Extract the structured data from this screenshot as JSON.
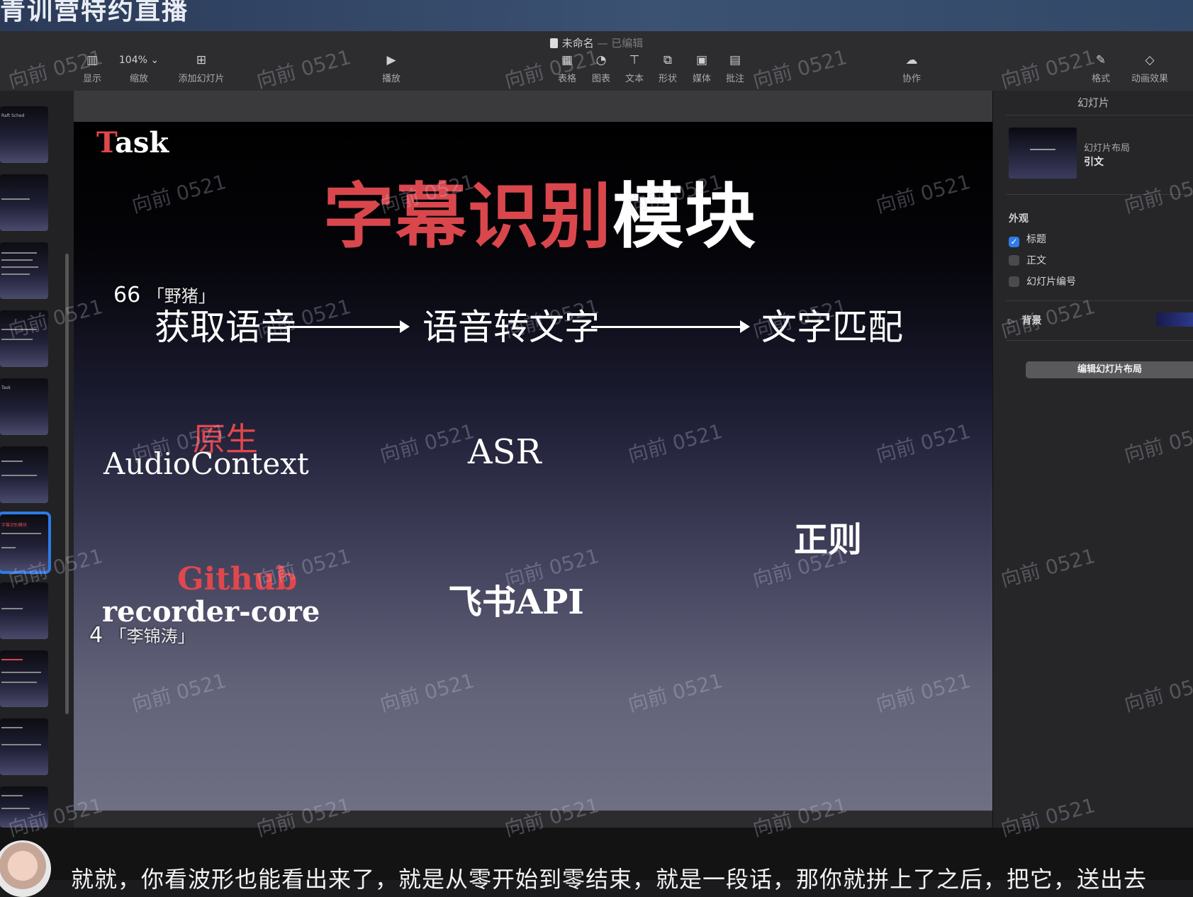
{
  "stream_banner": {
    "title": "青训营特约直播"
  },
  "toolbar": {
    "document_title": "未命名",
    "document_status": "— 已编辑",
    "view_label": "显示",
    "zoom_value": "104%",
    "zoom_label": "缩放",
    "add_slide_label": "添加幻灯片",
    "play_label": "播放",
    "table_label": "表格",
    "chart_label": "图表",
    "text_label": "文本",
    "shape_label": "形状",
    "media_label": "媒体",
    "comment_label": "批注",
    "collaborate_label": "协作",
    "format_label": "格式",
    "animate_label": "动画效果"
  },
  "navigator": {
    "thumbnails": [
      {
        "label": "Raft Sched"
      },
      {
        "label": ""
      },
      {
        "label": ""
      },
      {
        "label": ""
      },
      {
        "label": "Task"
      },
      {
        "label": ""
      },
      {
        "label": "字幕识别模块"
      },
      {
        "label": ""
      },
      {
        "label": ""
      },
      {
        "label": ""
      },
      {
        "label": ""
      }
    ],
    "selected_index": 6
  },
  "slide": {
    "task_first_letter": "T",
    "task_rest": "ask",
    "title_red": "字幕识别",
    "title_white": "模块",
    "flow_step1": "获取语音",
    "flow_step2": "语音转文字",
    "flow_step3": "文字匹配",
    "native_label": "原生",
    "audio_context": "AudioContext",
    "asr": "ASR",
    "regex": "正则",
    "github_label": "Github",
    "recorder_core": "recorder-core",
    "feishu_api": "飞书API"
  },
  "danmaku": [
    {
      "count": "66",
      "name": "「野猪」"
    },
    {
      "count": "4",
      "name": "「李锦涛」"
    }
  ],
  "inspector": {
    "header": "幻灯片",
    "layout_label": "幻灯片布局",
    "layout_value": "引文",
    "appearance_label": "外观",
    "title_option": "标题",
    "title_checked": true,
    "body_option": "正文",
    "body_checked": false,
    "slide_number_option": "幻灯片编号",
    "slide_number_checked": false,
    "background_label": "背景",
    "background_color": "#2c3a8c",
    "edit_layout_button": "编辑幻灯片布局"
  },
  "subtitle": {
    "text": "就就，你看波形也能看出来了，就是从零开始到零结束，就是一段话，那你就拼上了之后，把它，送出去"
  },
  "watermark": {
    "text": "向前 0521"
  },
  "colors": {
    "accent": "#2f7be8",
    "slide_red": "#d9474d"
  }
}
